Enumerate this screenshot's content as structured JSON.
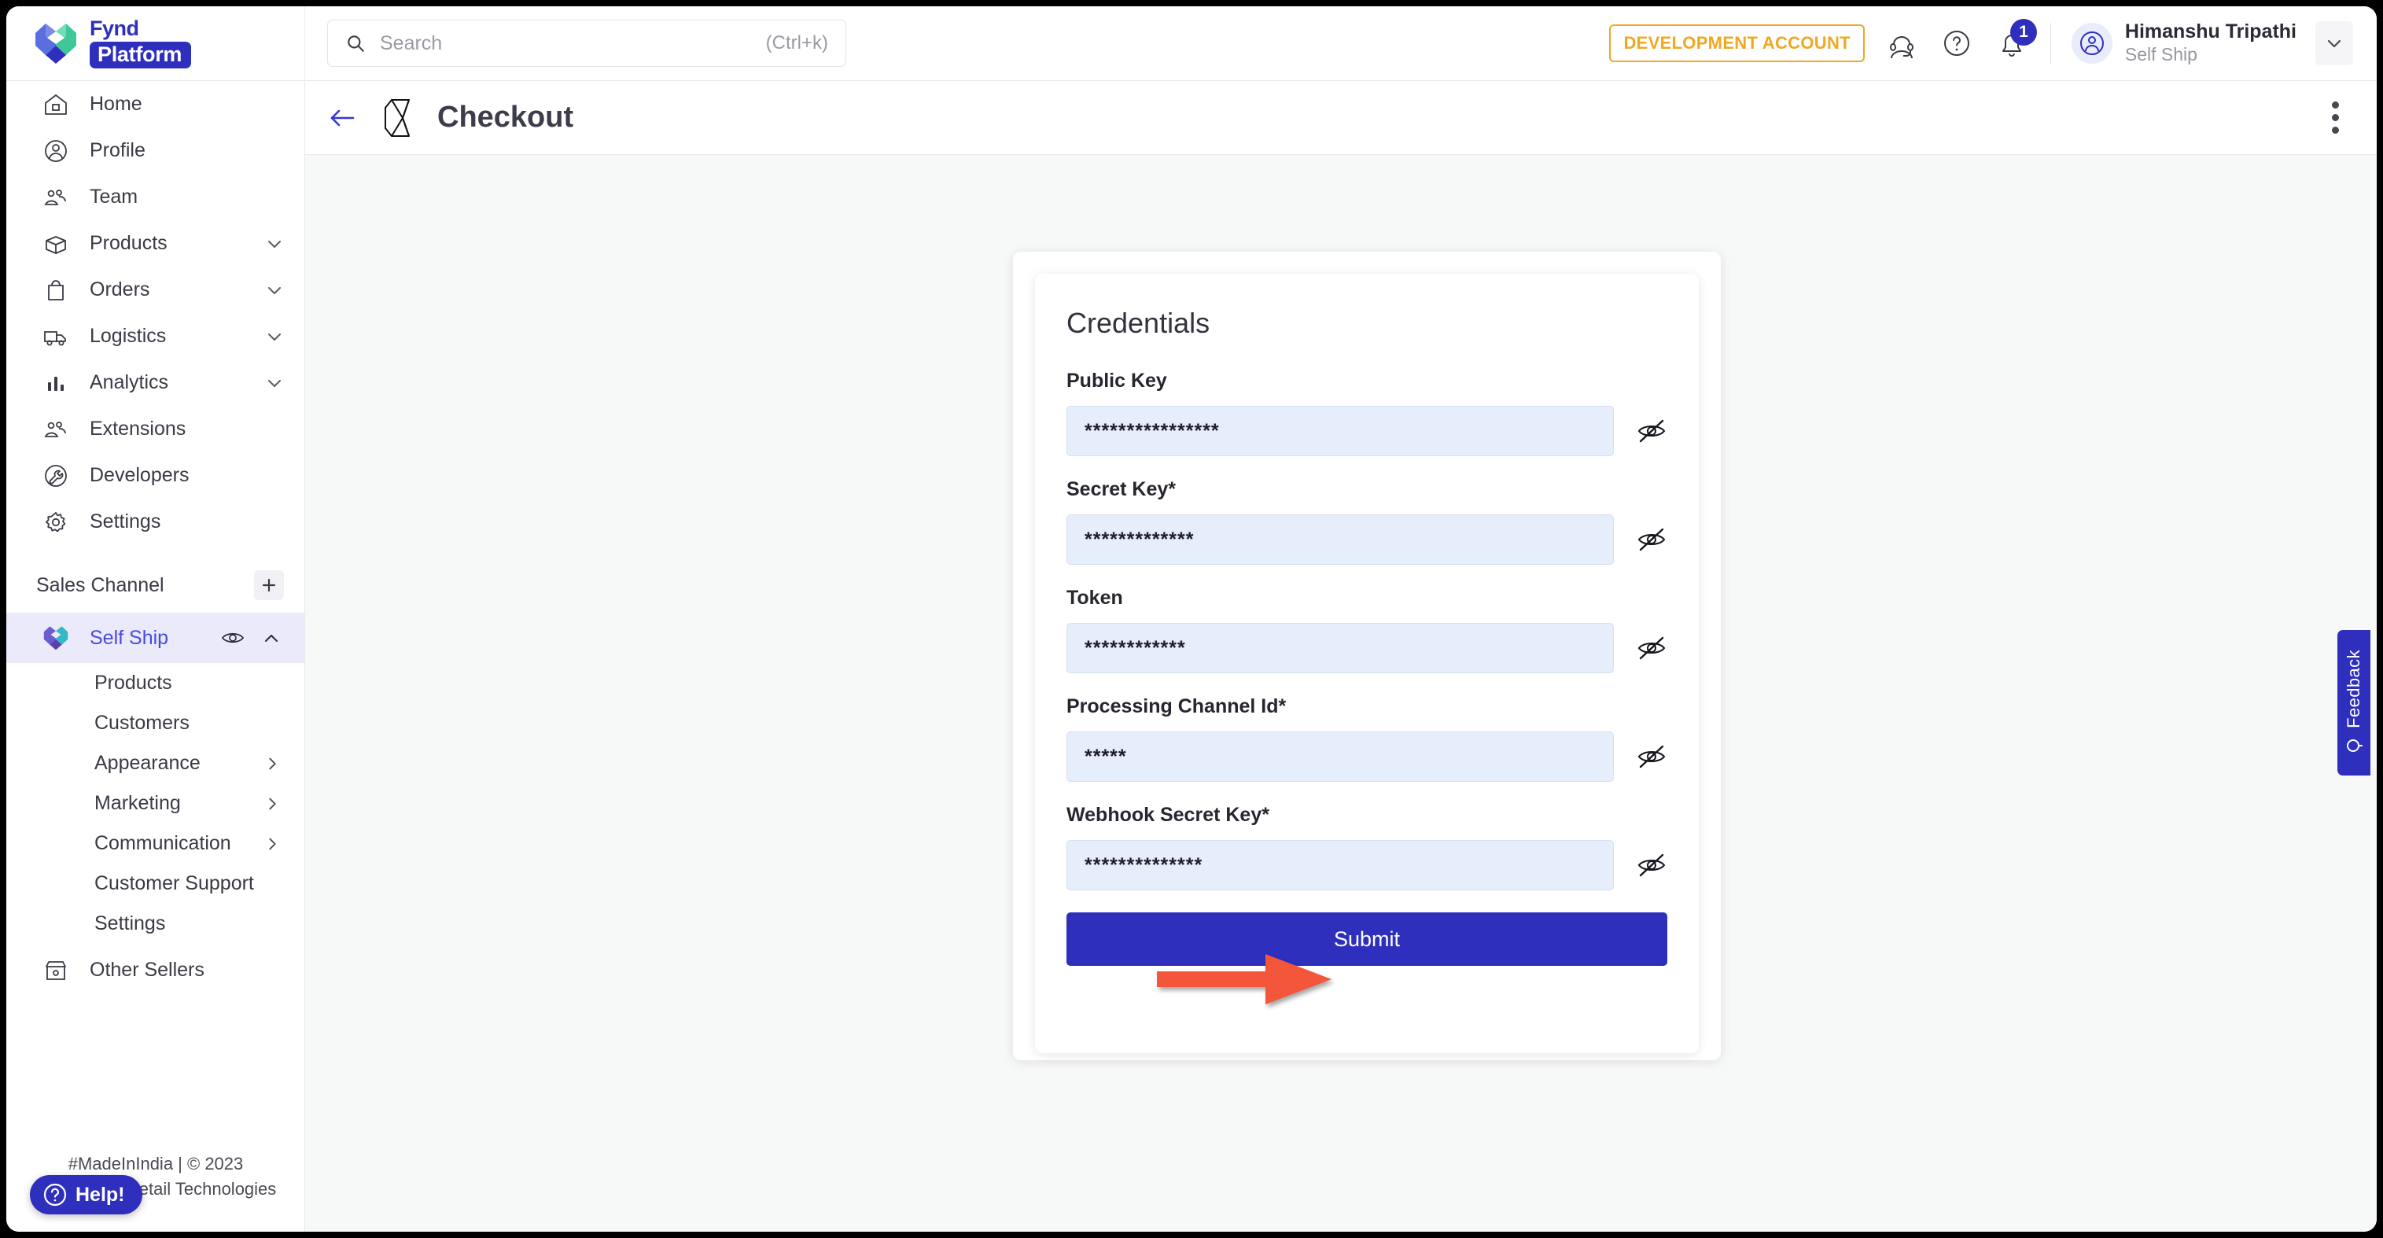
{
  "brand": {
    "logo_top": "Fynd",
    "logo_bottom": "Platform",
    "logo_icon": "fynd-heart-logo",
    "accent_blue": "#2f2fbe",
    "accent_amber": "#f0a81e",
    "active_nav_bg": "#eaeafa",
    "input_bg": "#e6edfb",
    "annotation_red": "#f4563c"
  },
  "topbar": {
    "search": {
      "icon": "search-icon",
      "placeholder": "Search",
      "shortcut": "(Ctrl+k)",
      "value": ""
    },
    "dev_badge": "DEVELOPMENT ACCOUNT",
    "icons": [
      {
        "name": "support-headset-icon"
      },
      {
        "name": "help-circle-icon"
      },
      {
        "name": "notification-bell-icon",
        "badge": "1"
      }
    ],
    "user": {
      "avatar_icon": "user-avatar-icon",
      "name": "Himanshu Tripathi",
      "subtitle": "Self Ship",
      "chevron": "chevron-down-icon"
    }
  },
  "sidebar": {
    "items": [
      {
        "label": "Home",
        "icon": "home-icon",
        "expandable": false
      },
      {
        "label": "Profile",
        "icon": "profile-icon",
        "expandable": false
      },
      {
        "label": "Team",
        "icon": "team-icon",
        "expandable": false
      },
      {
        "label": "Products",
        "icon": "box-icon",
        "expandable": true
      },
      {
        "label": "Orders",
        "icon": "bag-icon",
        "expandable": true
      },
      {
        "label": "Logistics",
        "icon": "truck-icon",
        "expandable": true
      },
      {
        "label": "Analytics",
        "icon": "bar-chart-icon",
        "expandable": true
      },
      {
        "label": "Extensions",
        "icon": "extensions-icon",
        "expandable": false
      },
      {
        "label": "Developers",
        "icon": "wrench-circle-icon",
        "expandable": false
      },
      {
        "label": "Settings",
        "icon": "gear-icon",
        "expandable": false
      }
    ],
    "sales_channel": {
      "title": "Sales Channel",
      "add_icon": "plus-icon"
    },
    "active_channel": {
      "label": "Self Ship",
      "icon": "fynd-heart-logo",
      "eye_icon": "eye-icon",
      "collapse_icon": "chevron-up-icon"
    },
    "channel_items": [
      {
        "label": "Products",
        "has_arrow": false
      },
      {
        "label": "Customers",
        "has_arrow": false
      },
      {
        "label": "Appearance",
        "has_arrow": true
      },
      {
        "label": "Marketing",
        "has_arrow": true
      },
      {
        "label": "Communication",
        "has_arrow": true
      },
      {
        "label": "Customer Support",
        "has_arrow": false
      },
      {
        "label": "Settings",
        "has_arrow": false
      }
    ],
    "other_sellers": {
      "label": "Other Sellers",
      "icon": "storefront-icon"
    },
    "footer_line1": "#MadeInIndia | © 2023",
    "footer_line2": "Shopsense Retail Technologies",
    "help_button": {
      "label": "Help!",
      "icon": "question-circle-icon"
    }
  },
  "page": {
    "back_icon": "back-arrow-icon",
    "app_logo_icon": "checkout-extension-logo",
    "title": "Checkout",
    "kebab_icon": "more-vertical-icon"
  },
  "card": {
    "title": "Credentials",
    "fields": [
      {
        "label": "Public Key",
        "value": "****************",
        "toggle_icon": "eye-off-icon"
      },
      {
        "label": "Secret Key*",
        "value": "*************",
        "toggle_icon": "eye-off-icon"
      },
      {
        "label": "Token",
        "value": "************",
        "toggle_icon": "eye-off-icon"
      },
      {
        "label": "Processing Channel Id*",
        "value": "*****",
        "toggle_icon": "eye-off-icon"
      },
      {
        "label": "Webhook Secret Key*",
        "value": "**************",
        "toggle_icon": "eye-off-icon"
      }
    ],
    "submit_label": "Submit"
  },
  "feedback_tab": {
    "label": "Feedback",
    "icon": "chat-bubble-icon"
  },
  "annotation": {
    "type": "arrow-pointing-right",
    "target": "submit-button"
  }
}
